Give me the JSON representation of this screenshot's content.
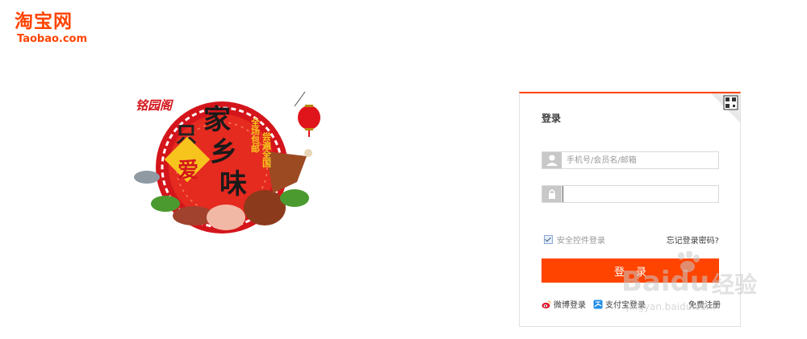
{
  "logo": {
    "cn": "淘宝网",
    "en": "Taobao.com"
  },
  "promo": {
    "brand": "铭园阁",
    "left_chars": [
      "只",
      "爱"
    ],
    "main_chars": [
      "家",
      "乡",
      "味"
    ],
    "side_text": [
      "全场包邮",
      "尝遍全国"
    ]
  },
  "login": {
    "title": "登录",
    "username_placeholder": "手机号/会员名/邮箱",
    "password_value": "",
    "secure_login_label": "安全控件登录",
    "forgot_password": "忘记登录密码?",
    "submit_label": "登录",
    "weibo_login": "微博登录",
    "alipay_login": "支付宝登录",
    "register": "免费注册"
  },
  "watermark": {
    "brand": "Baidu",
    "suffix": "经验",
    "url": "jingyan.baidu.com"
  },
  "colors": {
    "accent": "#ff4400",
    "promo_red": "#e0141b",
    "gold": "#f7c41d"
  },
  "icons": {
    "user": "user-icon",
    "lock": "lock-icon",
    "qr": "qr-code-icon",
    "weibo": "weibo-icon",
    "alipay": "alipay-icon"
  }
}
